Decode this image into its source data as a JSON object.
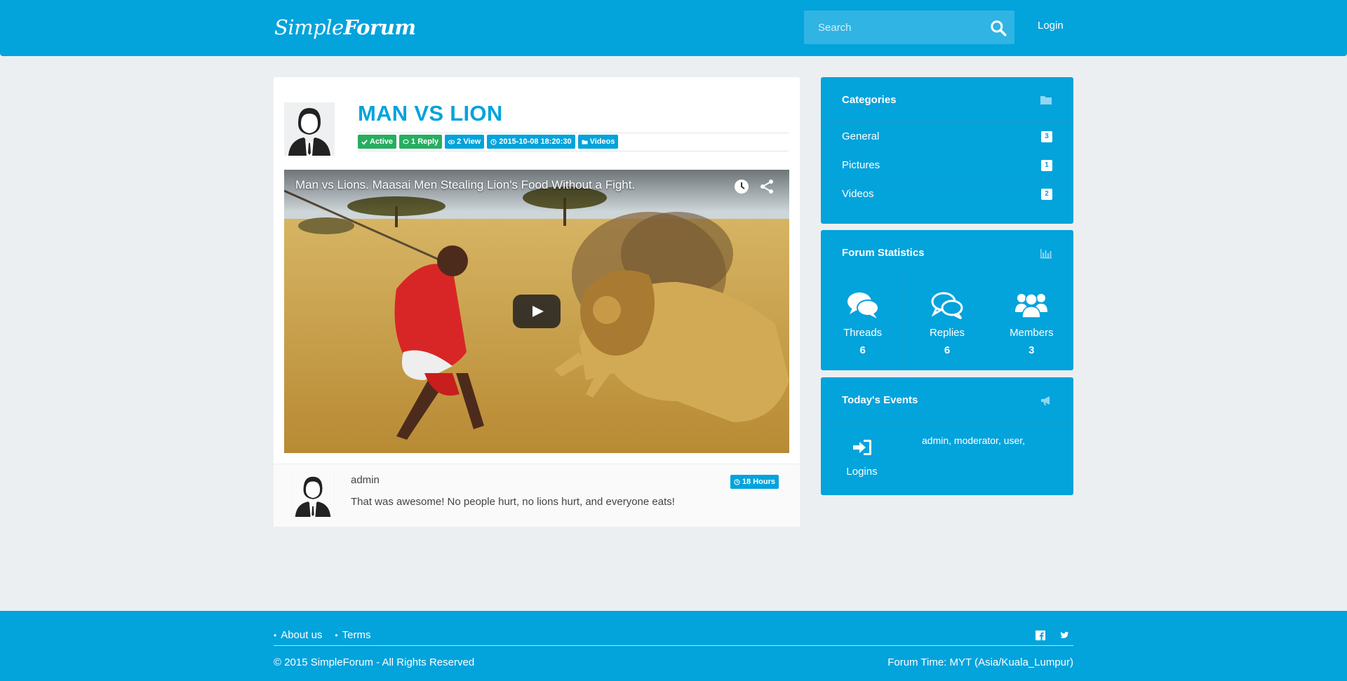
{
  "header": {
    "brand_light": "Simple",
    "brand_bold": "Forum",
    "search_placeholder": "Search",
    "login": "Login"
  },
  "thread": {
    "title": "MAN VS LION",
    "badges": {
      "status": "Active",
      "replies": "1 Reply",
      "views": "2 View",
      "date": "2015-10-08 18:20:30",
      "category": "Videos"
    },
    "video_title": "Man vs Lions. Maasai Men Stealing Lion's Food Without a Fight."
  },
  "reply": {
    "author": "admin",
    "time": "18 Hours",
    "text": "That was awesome! No people hurt, no lions hurt, and everyone eats!"
  },
  "categories": {
    "title": "Categories",
    "items": [
      {
        "label": "General",
        "count": "3"
      },
      {
        "label": "Pictures",
        "count": "1"
      },
      {
        "label": "Videos",
        "count": "2"
      }
    ]
  },
  "statistics": {
    "title": "Forum Statistics",
    "items": [
      {
        "label": "Threads",
        "value": "6"
      },
      {
        "label": "Replies",
        "value": "6"
      },
      {
        "label": "Members",
        "value": "3"
      }
    ]
  },
  "events": {
    "title": "Today's Events",
    "logins_label": "Logins",
    "users": "admin, moderator, user,"
  },
  "footer": {
    "links": [
      "About us",
      "Terms"
    ],
    "copyright": "© 2015 SimpleForum - All Rights Reserved",
    "forum_time": "Forum Time: MYT (Asia/Kuala_Lumpur)"
  },
  "colors": {
    "primary": "#03a3dc",
    "success": "#27ae60",
    "background": "#eceff1"
  }
}
